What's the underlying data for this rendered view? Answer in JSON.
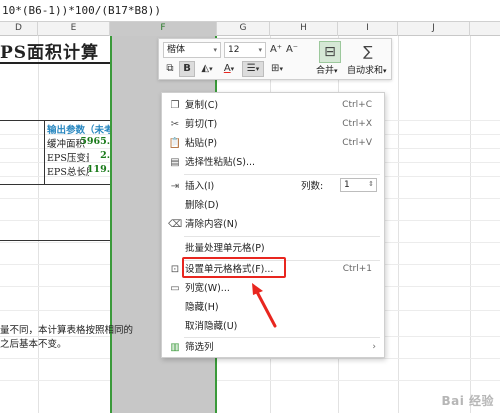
{
  "formula_bar": {
    "text": "10*(B6-1))*100/(B17*B8))"
  },
  "columns": [
    "D",
    "E",
    "F",
    "G",
    "H",
    "I",
    "J"
  ],
  "selected_column": "F",
  "sheet": {
    "title_fragment": "PS面积计算",
    "output_header": "输出参数（未考虑安",
    "rows": [
      {
        "label": "缓冲面积",
        "value": "5965."
      },
      {
        "label": "EPS压变量",
        "value": "2."
      },
      {
        "label": "EPS总长度",
        "value": "119."
      }
    ],
    "note_line1": "量不同，本计算表格按照相同的",
    "note_line1_tail": "？",
    "note_line2": "之后基本不变。"
  },
  "toolbar": {
    "font_name": "楷体",
    "font_size": "12",
    "grow_font": "A⁺",
    "shrink_font": "A⁻",
    "bold": "B",
    "merge_label": "合并",
    "autosum_label": "自动求和",
    "accent_color": "#3a9a3a",
    "font_color_bar": "#e8261f"
  },
  "context_menu": {
    "items": [
      {
        "label": "复制(C)",
        "shortcut": "Ctrl+C",
        "icon": "copy-icon"
      },
      {
        "label": "剪切(T)",
        "shortcut": "Ctrl+X",
        "icon": "scissors-icon"
      },
      {
        "label": "粘贴(P)",
        "shortcut": "Ctrl+V",
        "icon": "paste-icon"
      },
      {
        "label": "选择性粘贴(S)...",
        "shortcut": "",
        "icon": "paste-special-icon"
      },
      {
        "label": "插入(I)",
        "shortcut": "",
        "icon": "insert-column-icon"
      },
      {
        "label": "删除(D)",
        "shortcut": "",
        "icon": ""
      },
      {
        "label": "清除内容(N)",
        "shortcut": "",
        "icon": "eraser-icon"
      },
      {
        "label": "批量处理单元格(P)",
        "shortcut": "",
        "icon": ""
      },
      {
        "label": "设置单元格格式(F)...",
        "shortcut": "Ctrl+1",
        "icon": "format-cells-icon"
      },
      {
        "label": "列宽(W)...",
        "shortcut": "",
        "icon": "column-width-icon"
      },
      {
        "label": "隐藏(H)",
        "shortcut": "",
        "icon": ""
      },
      {
        "label": "取消隐藏(U)",
        "shortcut": "",
        "icon": ""
      },
      {
        "label": "筛选列",
        "shortcut": "",
        "icon": "filter-icon"
      }
    ],
    "column_count_label": "列数:",
    "column_count_value": "1",
    "submenu_arrow": "›"
  },
  "watermark": "Bai 经验"
}
